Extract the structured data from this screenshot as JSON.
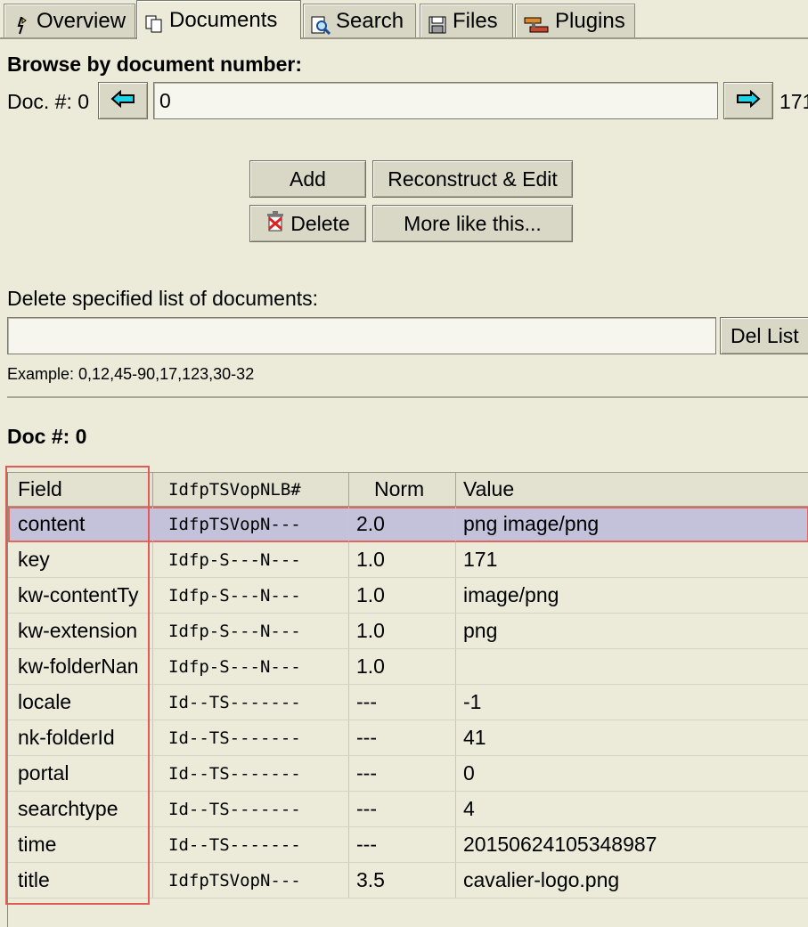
{
  "tabs": [
    {
      "label": "Overview",
      "icon": "wizard-icon"
    },
    {
      "label": "Documents",
      "icon": "documents-icon"
    },
    {
      "label": "Search",
      "icon": "search-icon"
    },
    {
      "label": "Files",
      "icon": "files-icon"
    },
    {
      "label": "Plugins",
      "icon": "plugins-icon"
    }
  ],
  "browse": {
    "heading": "Browse by document number:",
    "doc_label": "Doc. #: 0",
    "doc_input_value": "0",
    "total_count": "171"
  },
  "actions": {
    "add": "Add",
    "reconstruct": "Reconstruct & Edit",
    "delete": "Delete",
    "more_like": "More like this..."
  },
  "delete_list": {
    "label": "Delete specified list of documents:",
    "input_value": "",
    "button": "Del List",
    "example": "Example: 0,12,45-90,17,123,30-32"
  },
  "doc_heading": "Doc #: 0",
  "table": {
    "headers": [
      "Field",
      "IdfpTSVopNLB#",
      "Norm",
      "Value"
    ],
    "rows": [
      {
        "field": "content",
        "flags": "IdfpTSVopN---",
        "norm": "2.0",
        "value": "png image/png"
      },
      {
        "field": "key",
        "flags": "Idfp-S---N---",
        "norm": "1.0",
        "value": "171"
      },
      {
        "field": "kw-contentTy",
        "flags": "Idfp-S---N---",
        "norm": "1.0",
        "value": "image/png"
      },
      {
        "field": "kw-extension",
        "flags": "Idfp-S---N---",
        "norm": "1.0",
        "value": "png"
      },
      {
        "field": "kw-folderNan",
        "flags": "Idfp-S---N---",
        "norm": "1.0",
        "value": ""
      },
      {
        "field": "locale",
        "flags": "Id--TS-------",
        "norm": "---",
        "value": "-1"
      },
      {
        "field": "nk-folderId",
        "flags": "Id--TS-------",
        "norm": "---",
        "value": "41"
      },
      {
        "field": "portal",
        "flags": "Id--TS-------",
        "norm": "---",
        "value": "0"
      },
      {
        "field": "searchtype",
        "flags": "Id--TS-------",
        "norm": "---",
        "value": "4"
      },
      {
        "field": "time",
        "flags": "Id--TS-------",
        "norm": "---",
        "value": "20150624105348987"
      },
      {
        "field": "title",
        "flags": "IdfpTSVopN---",
        "norm": "3.5",
        "value": "cavalier-logo.png"
      }
    ],
    "selected_row": 0
  },
  "colors": {
    "background": "#ecead9",
    "selection": "#c3c2da",
    "highlight_border": "#df5b55",
    "arrow_cyan": "#1fd3e6"
  }
}
